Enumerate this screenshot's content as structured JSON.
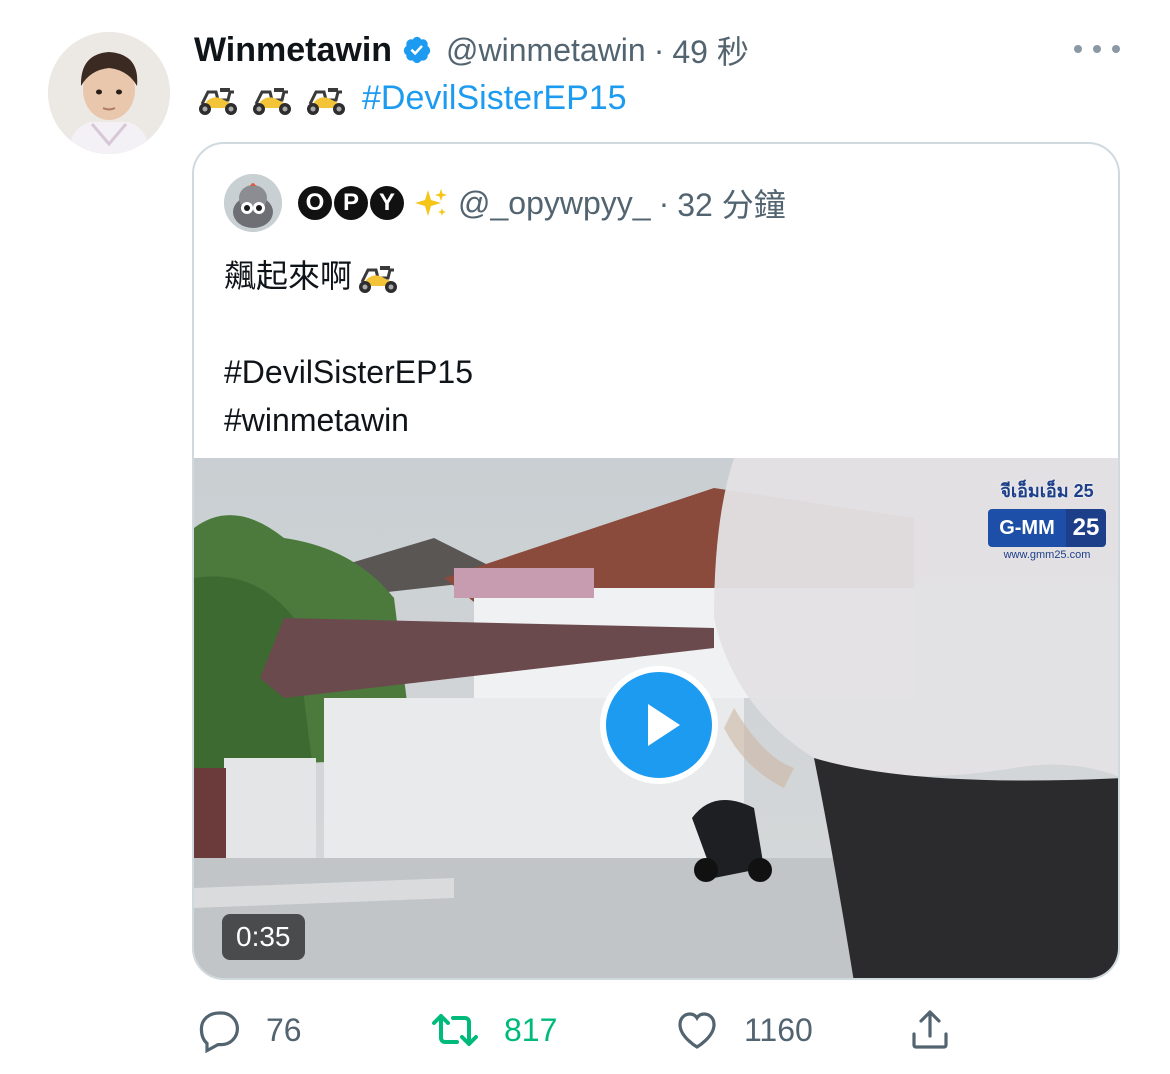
{
  "tweet": {
    "author_name": "Winmetawin",
    "handle": "@winmetawin",
    "separator": "·",
    "time": "49 秒",
    "emoji": [
      "scooter-emoji",
      "scooter-emoji",
      "scooter-emoji"
    ],
    "hashtag": "#DevilSisterEP15"
  },
  "quoted": {
    "name_letters": [
      "O",
      "P",
      "Y"
    ],
    "name_emoji": "sparkles-emoji",
    "handle": "@_opywpyy_",
    "separator": "·",
    "time": "32 分鐘",
    "line1": "飆起來啊",
    "line1_emoji": "scooter-emoji",
    "line3": "#DevilSisterEP15",
    "line4": "#winmetawin",
    "media": {
      "type": "video",
      "duration": "0:35",
      "watermark_thai": "จีเอ็มเอ็ม 25",
      "watermark_logo_left": "G-MM",
      "watermark_logo_right": "25",
      "watermark_url": "www.gmm25.com"
    }
  },
  "actions": {
    "reply_count": "76",
    "retweet_count": "817",
    "like_count": "1160"
  },
  "colors": {
    "accent": "#1d9bf0",
    "retweet_green": "#00ba7c",
    "secondary_text": "#536471"
  }
}
